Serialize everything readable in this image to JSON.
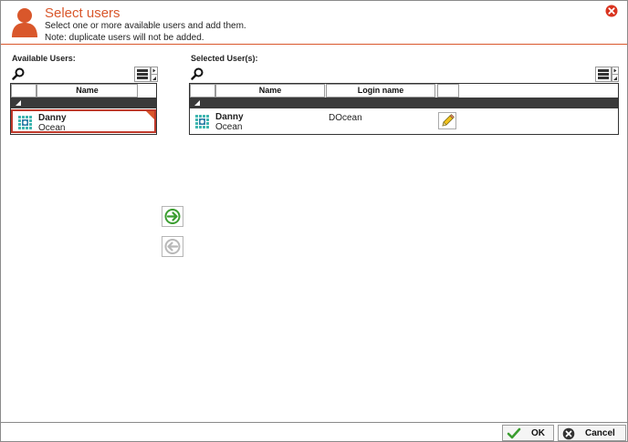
{
  "header": {
    "title": "Select users",
    "subtitle_line1": "Select one or more available users and add them.",
    "subtitle_line2": "Note: duplicate users will not be added."
  },
  "available": {
    "label": "Available Users:",
    "columns": [
      "",
      "Name"
    ],
    "rows": [
      {
        "first": "Danny",
        "last": "Ocean"
      }
    ]
  },
  "selected": {
    "label": "Selected User(s):",
    "columns": [
      "",
      "Name",
      "Login name",
      ""
    ],
    "rows": [
      {
        "first": "Danny",
        "last": "Ocean",
        "login": "DOcean"
      }
    ]
  },
  "footer": {
    "ok_label": "OK",
    "cancel_label": "Cancel"
  },
  "colors": {
    "accent": "#d9572b",
    "group_bar": "#3a3a3a",
    "add_arrow": "#3a9d2f",
    "remove_arrow": "#b8b8b8"
  }
}
